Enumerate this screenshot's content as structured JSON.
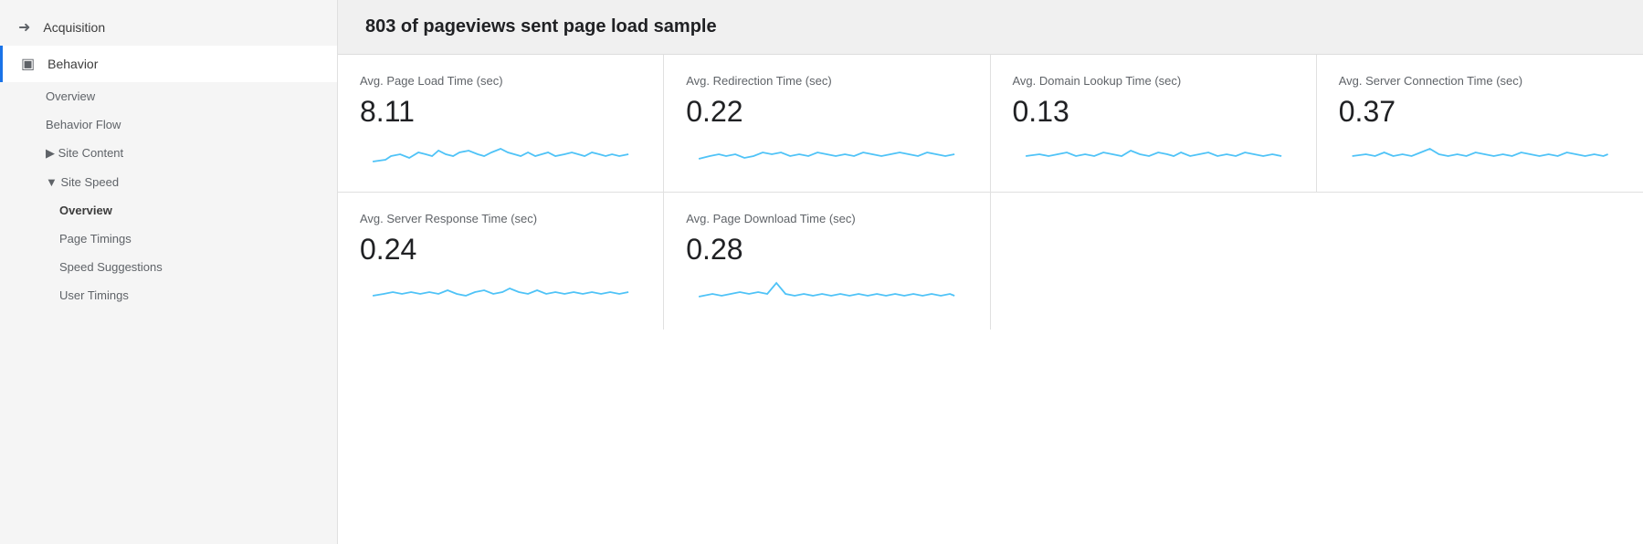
{
  "sidebar": {
    "acquisition_label": "Acquisition",
    "behavior_label": "Behavior",
    "overview_label": "Overview",
    "behavior_flow_label": "Behavior Flow",
    "site_content_label": "Site Content",
    "site_speed_label": "Site Speed",
    "site_speed_overview_label": "Overview",
    "page_timings_label": "Page Timings",
    "speed_suggestions_label": "Speed Suggestions",
    "user_timings_label": "User Timings"
  },
  "header": {
    "title": "803 of pageviews sent page load sample"
  },
  "metrics": [
    {
      "label": "Avg. Page Load Time (sec)",
      "value": "8.11"
    },
    {
      "label": "Avg. Redirection Time (sec)",
      "value": "0.22"
    },
    {
      "label": "Avg. Domain Lookup Time (sec)",
      "value": "0.13"
    },
    {
      "label": "Avg. Server Connection Time (sec)",
      "value": "0.37"
    },
    {
      "label": "Avg. Server Response Time (sec)",
      "value": "0.24"
    },
    {
      "label": "Avg. Page Download Time (sec)",
      "value": "0.28"
    }
  ]
}
